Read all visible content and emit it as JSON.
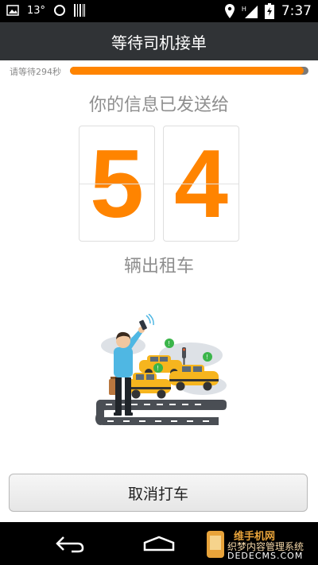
{
  "status_bar": {
    "temperature": "13°",
    "time": "7:37",
    "icons": [
      "image-icon",
      "circle-icon",
      "barcode-icon",
      "location-icon",
      "signal-icon",
      "battery-icon"
    ]
  },
  "title": "等待司机接单",
  "wait": {
    "text": "请等待294秒",
    "progress_fraction": 0.98,
    "bar_color": "#ff8400"
  },
  "headline": "你的信息已发送给",
  "counter": {
    "digits": [
      "5",
      "4"
    ],
    "color": "#ff8400"
  },
  "subline": "辆出租车",
  "cancel_button": "取消打车",
  "nav_bar": {
    "icons": [
      "back-icon",
      "home-icon"
    ]
  },
  "watermark": {
    "line1": "维手机网",
    "line2": "织梦内容管理系统",
    "line3": "DEDECMS.COM"
  }
}
